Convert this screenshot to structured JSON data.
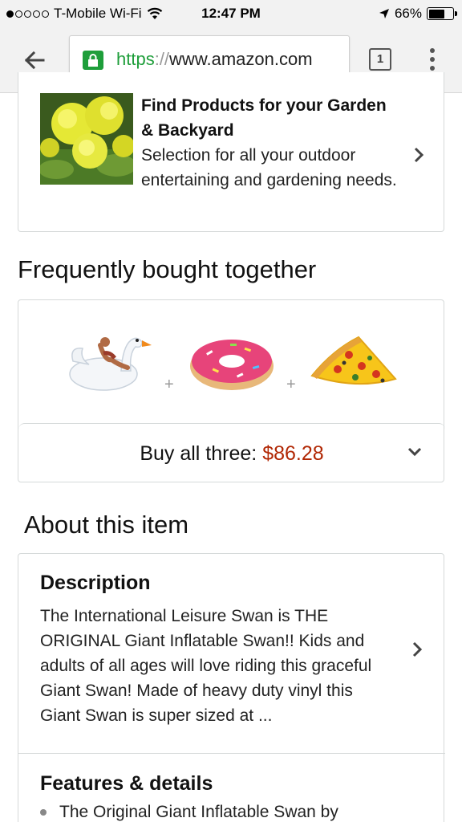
{
  "status_bar": {
    "carrier": "T-Mobile Wi-Fi",
    "time": "12:47 PM",
    "battery": "66%",
    "battery_level": 0.66
  },
  "browser": {
    "url_scheme": "https",
    "url_sep": "://",
    "url_host": "www.amazon.com",
    "tab_count": "1"
  },
  "promo": {
    "title": "Find Products for your Garden & Backyard",
    "description": "Selection for all your outdoor entertaining and gardening needs."
  },
  "fbt": {
    "heading": "Frequently bought together",
    "plus": "+",
    "buy_label": "Buy all three: ",
    "price": "$86.28"
  },
  "about": {
    "heading": "About this item",
    "description_title": "Description",
    "description_text": "The International Leisure Swan is THE ORIGINAL Giant Inflatable Swan!! Kids and adults of all ages will love riding this graceful Giant Swan! Made of heavy duty vinyl this Giant Swan is super sized at ...",
    "features_title": "Features & details",
    "features": [
      "The Original Giant Inflatable Swan by"
    ]
  },
  "colors": {
    "price": "#b12704",
    "secure_green": "#1e9e3a"
  }
}
